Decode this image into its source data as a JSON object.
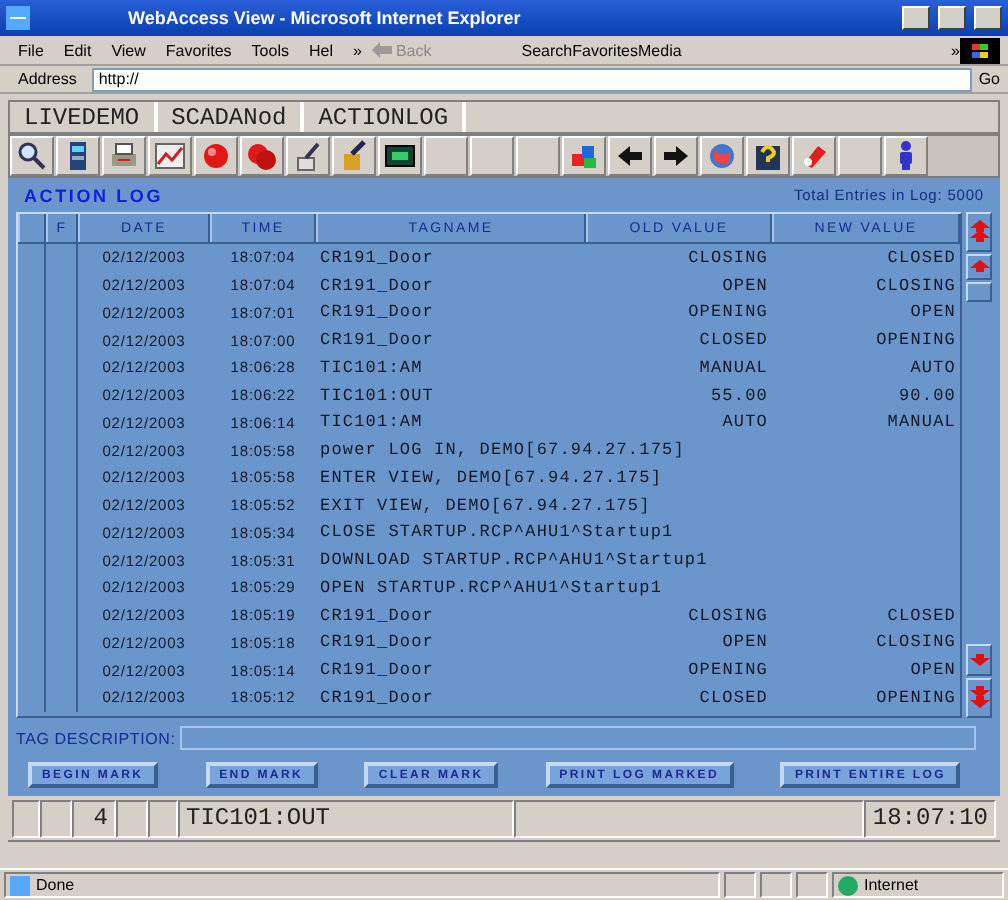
{
  "window": {
    "title": "WebAccess View - Microsoft Internet Explorer"
  },
  "menu": [
    "File",
    "Edit",
    "View",
    "Favorites",
    "Tools",
    "Hel"
  ],
  "menu_more": "»",
  "toolbar": {
    "back": "Back",
    "search": "Search",
    "favorites": "Favorites",
    "media": "Media",
    "more": "»"
  },
  "address": {
    "label": "Address",
    "value": "http://",
    "go": "Go"
  },
  "app_tabs": [
    "LIVEDEMO",
    "SCADANod",
    "ACTIONLOG"
  ],
  "panel": {
    "title": "ACTION LOG",
    "total": "Total Entries in Log: 5000"
  },
  "table": {
    "columns": [
      "F",
      "DATE",
      "TIME",
      "TAGNAME",
      "OLD VALUE",
      "NEW VALUE"
    ],
    "rows": [
      [
        "",
        "02/12/2003",
        "18:07:04",
        "CR191_Door",
        "CLOSING",
        "CLOSED"
      ],
      [
        "",
        "02/12/2003",
        "18:07:04",
        "CR191_Door",
        "OPEN",
        "CLOSING"
      ],
      [
        "",
        "02/12/2003",
        "18:07:01",
        "CR191_Door",
        "OPENING",
        "OPEN"
      ],
      [
        "",
        "02/12/2003",
        "18:07:00",
        "CR191_Door",
        "CLOSED",
        "OPENING"
      ],
      [
        "",
        "02/12/2003",
        "18:06:28",
        "TIC101:AM",
        "MANUAL",
        "AUTO"
      ],
      [
        "",
        "02/12/2003",
        "18:06:22",
        "TIC101:OUT",
        "55.00",
        "90.00"
      ],
      [
        "",
        "02/12/2003",
        "18:06:14",
        "TIC101:AM",
        "AUTO",
        "MANUAL"
      ],
      [
        "",
        "02/12/2003",
        "18:05:58",
        "power LOG IN, DEMO[67.94.27.175]"
      ],
      [
        "",
        "02/12/2003",
        "18:05:58",
        "ENTER VIEW, DEMO[67.94.27.175]"
      ],
      [
        "",
        "02/12/2003",
        "18:05:52",
        "EXIT VIEW, DEMO[67.94.27.175]"
      ],
      [
        "",
        "02/12/2003",
        "18:05:34",
        "CLOSE STARTUP.RCP^AHU1^Startup1"
      ],
      [
        "",
        "02/12/2003",
        "18:05:31",
        "DOWNLOAD STARTUP.RCP^AHU1^Startup1"
      ],
      [
        "",
        "02/12/2003",
        "18:05:29",
        "OPEN STARTUP.RCP^AHU1^Startup1"
      ],
      [
        "",
        "02/12/2003",
        "18:05:19",
        "CR191_Door",
        "CLOSING",
        "CLOSED"
      ],
      [
        "",
        "02/12/2003",
        "18:05:18",
        "CR191_Door",
        "OPEN",
        "CLOSING"
      ],
      [
        "",
        "02/12/2003",
        "18:05:14",
        "CR191_Door",
        "OPENING",
        "OPEN"
      ],
      [
        "",
        "02/12/2003",
        "18:05:12",
        "CR191_Door",
        "CLOSED",
        "OPENING"
      ]
    ]
  },
  "tag_description": {
    "label": "TAG DESCRIPTION:"
  },
  "buttons": [
    "BEGIN MARK",
    "END MARK",
    "CLEAR MARK",
    "PRINT LOG MARKED",
    "PRINT ENTIRE LOG"
  ],
  "app_status": {
    "number": "4",
    "tag": "TIC101:OUT",
    "time": "18:07:10"
  },
  "status_bar": {
    "text": "Done",
    "zone": "Internet"
  }
}
